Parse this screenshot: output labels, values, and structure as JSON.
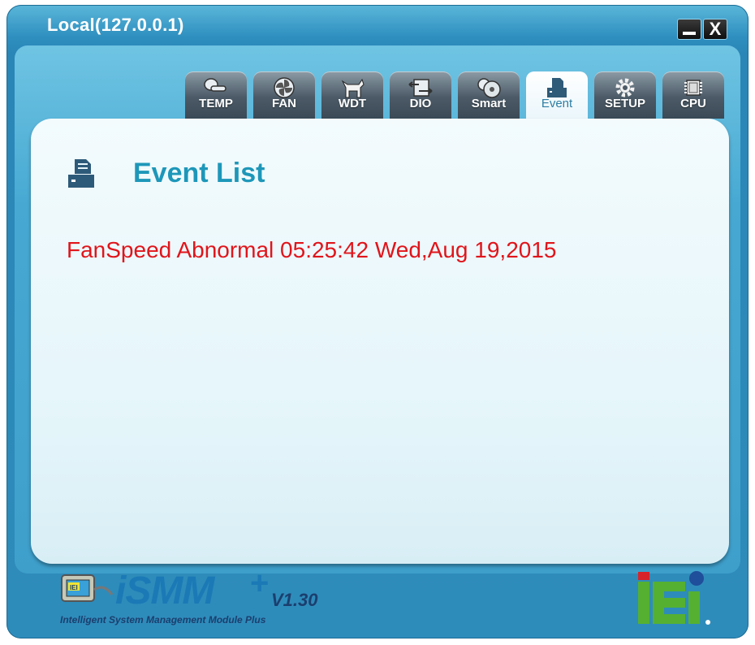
{
  "window": {
    "title": "Local(127.0.0.1)",
    "minimize_icon": "minimize-icon",
    "close_label": "X"
  },
  "tabs": [
    {
      "label": "TEMP",
      "icon": "thermometer-icon",
      "active": false
    },
    {
      "label": "FAN",
      "icon": "fan-icon",
      "active": false
    },
    {
      "label": "WDT",
      "icon": "watchdog-icon",
      "active": false
    },
    {
      "label": "DIO",
      "icon": "dio-icon",
      "active": false
    },
    {
      "label": "Smart",
      "icon": "smart-disk-icon",
      "active": false
    },
    {
      "label": "Event",
      "icon": "printer-icon",
      "active": true
    },
    {
      "label": "SETUP",
      "icon": "gear-icon",
      "active": false
    },
    {
      "label": "CPU",
      "icon": "chip-icon",
      "active": false
    }
  ],
  "panel": {
    "title": "Event List",
    "icon": "printer-icon",
    "events": [
      "FanSpeed Abnormal 05:25:42 Wed,Aug 19,2015"
    ]
  },
  "footer": {
    "brand_badge": "IEI",
    "logo_text": "iSMM",
    "logo_plus": "+",
    "version": "V1.30",
    "subtitle": "Intelligent System Management Module Plus",
    "company_logo": "iEi"
  },
  "colors": {
    "accent": "#1d97b9",
    "event_text": "#e0151b",
    "frame": "#2e8fbf"
  }
}
